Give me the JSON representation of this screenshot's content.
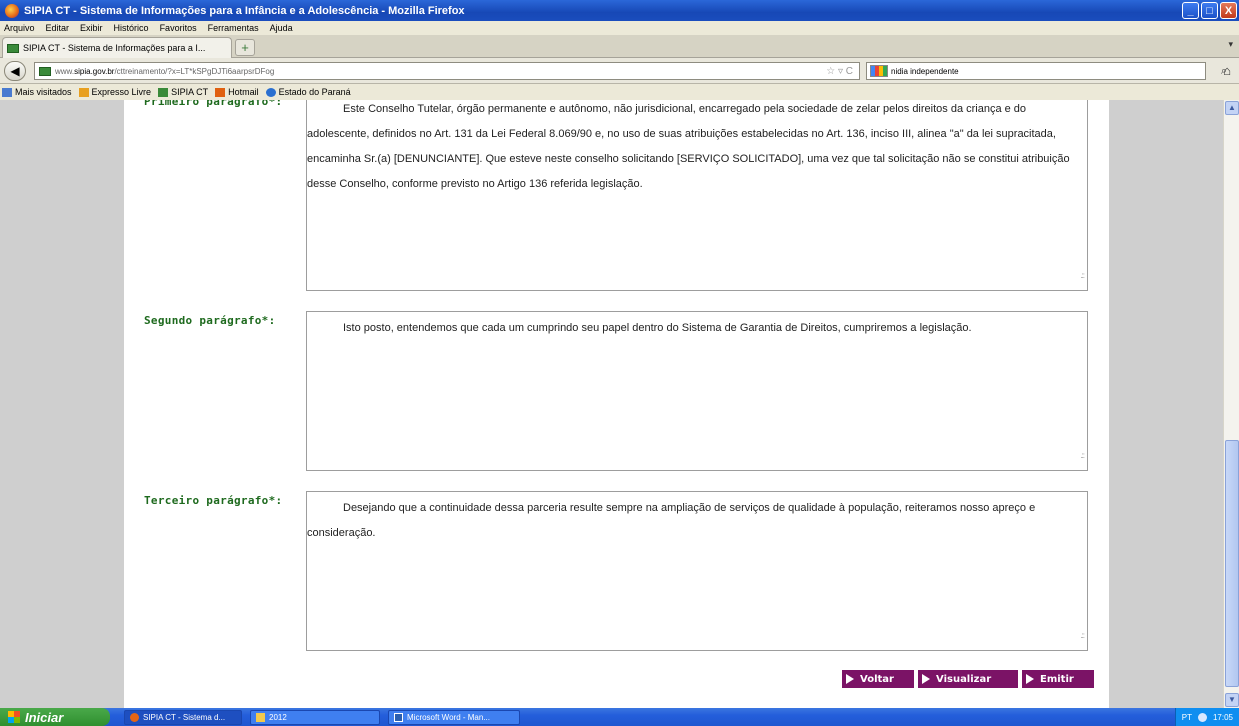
{
  "window": {
    "title": "SIPIA CT - Sistema de Informações para a Infância e a Adolescência - Mozilla Firefox",
    "buttons": [
      "_",
      "□",
      "X"
    ]
  },
  "menu": [
    "Arquivo",
    "Editar",
    "Exibir",
    "Histórico",
    "Favoritos",
    "Ferramentas",
    "Ajuda"
  ],
  "tab": {
    "label": "SIPIA CT - Sistema de Informações para a I...",
    "close": "×",
    "new": "+",
    "more": "▾"
  },
  "nav": {
    "back": "◀",
    "url_prefix": "www.",
    "url_domain": "sipia.gov.br",
    "url_path": "/cttreinamento/?x=LT*kSPgDJTi6aarpsrDFog",
    "url_controls": "☆ ▿ C",
    "search_value": "nidia independente",
    "search_icon": "⌕",
    "home": "⌂"
  },
  "bookmarks": [
    {
      "label": "Mais visitados",
      "icon": "bookmark-icon",
      "color": "#4a7bd0"
    },
    {
      "label": "Expresso Livre",
      "icon": "expresso-icon",
      "color": "#e8a020"
    },
    {
      "label": "SIPIA CT",
      "icon": "site-icon",
      "color": "#3a8a3a"
    },
    {
      "label": "Hotmail",
      "icon": "hotmail-icon",
      "color": "#e06010"
    },
    {
      "label": "Estado do Paraná",
      "icon": "parana-icon",
      "color": "#2a6fd0"
    }
  ],
  "form": {
    "p1_label": "Primeiro parágrafo*:",
    "p1_text": "Este Conselho Tutelar, órgão permanente e autônomo, não jurisdicional, encarregado pela sociedade de zelar pelos direitos da criança e do adolescente, definidos no Art. 131 da Lei Federal 8.069/90 e,  no uso de suas atribuições estabelecidas no Art. 136, inciso III, alinea \"a\" da lei supracitada, encaminha Sr.(a) [DENUNCIANTE]. Que esteve neste conselho solicitando [SERVIÇO SOLICITADO], uma vez que tal solicitação não se constitui atribuição desse Conselho, conforme previsto no Artigo 136 referida legislação.",
    "p2_label": "Segundo parágrafo*:",
    "p2_text": "Isto posto, entendemos que cada um cumprindo seu papel dentro do Sistema de Garantia de Direitos, cumpriremos a legislação.",
    "p3_label": "Terceiro parágrafo*:",
    "p3_text": "Desejando que a continuidade dessa parceria resulte sempre na ampliação de serviços de qualidade  à população, reiteramos nosso apreço e consideração.",
    "resize_glyph": ".::"
  },
  "actions": {
    "back": "Voltar",
    "preview": "Visualizar",
    "emit": "Emitir"
  },
  "scroll": {
    "up": "▲",
    "down": "▼"
  },
  "taskbar": {
    "start": "Iniciar",
    "tasks": [
      "SIPIA CT - Sistema d...",
      "2012",
      "Microsoft Word - Man..."
    ],
    "lang": "PT",
    "time": "17:05"
  },
  "colors": {
    "accent_button": "#7b1366",
    "label_green": "#1e6a1e",
    "titlebar": "#1748b6"
  }
}
